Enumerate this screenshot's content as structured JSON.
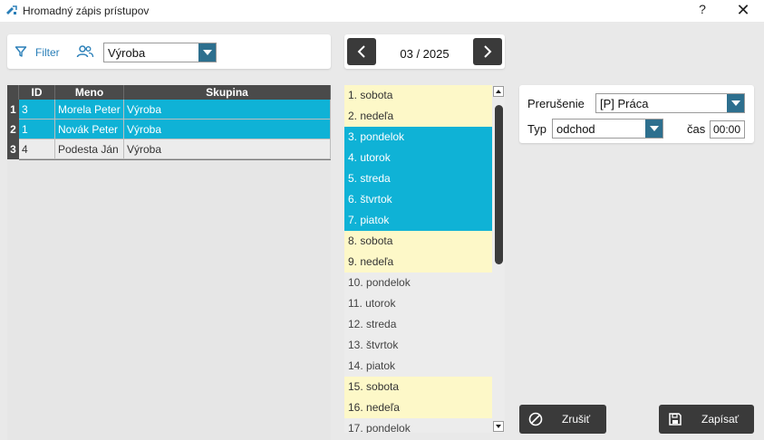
{
  "window": {
    "title": "Hromadný zápis prístupov",
    "help_label": "?",
    "close_label": "✕"
  },
  "filter": {
    "label": "Filter",
    "group_value": "Výroba"
  },
  "grid": {
    "headers": [
      "ID",
      "Meno",
      "Skupina"
    ],
    "rows": [
      {
        "num": "1",
        "id": "3",
        "name": "Morela Peter",
        "group": "Výroba",
        "selected": true
      },
      {
        "num": "2",
        "id": "1",
        "name": "Novák Peter",
        "group": "Výroba",
        "selected": true
      },
      {
        "num": "3",
        "id": "4",
        "name": "Podesta Ján",
        "group": "Výroba",
        "selected": false
      }
    ]
  },
  "month_nav": {
    "label": "03 / 2025"
  },
  "days": [
    {
      "label": "1. sobota",
      "kind": "weekend"
    },
    {
      "label": "2. nedeľa",
      "kind": "weekend"
    },
    {
      "label": "3. pondelok",
      "kind": "sel"
    },
    {
      "label": "4. utorok",
      "kind": "sel"
    },
    {
      "label": "5. streda",
      "kind": "sel"
    },
    {
      "label": "6. štvrtok",
      "kind": "sel"
    },
    {
      "label": "7. piatok",
      "kind": "sel"
    },
    {
      "label": "8. sobota",
      "kind": "weekend"
    },
    {
      "label": "9. nedeľa",
      "kind": "weekend"
    },
    {
      "label": "10. pondelok",
      "kind": "normal"
    },
    {
      "label": "11. utorok",
      "kind": "normal"
    },
    {
      "label": "12. streda",
      "kind": "normal"
    },
    {
      "label": "13. štvrtok",
      "kind": "normal"
    },
    {
      "label": "14. piatok",
      "kind": "normal"
    },
    {
      "label": "15. sobota",
      "kind": "weekend"
    },
    {
      "label": "16. nedeľa",
      "kind": "weekend"
    },
    {
      "label": "17. pondelok",
      "kind": "normal"
    }
  ],
  "form": {
    "interruption_label": "Prerušenie",
    "interruption_value": "[P] Práca",
    "type_label": "Typ",
    "type_value": "odchod",
    "time_label": "čas",
    "time_value": "00:00"
  },
  "buttons": {
    "cancel_label": "Zrušiť",
    "save_label": "Zapísať"
  },
  "colors": {
    "accent": "#0fb2d6",
    "weekend": "#fdf8c8",
    "dark": "#3a3a3a",
    "combo_button": "#2d6f8e"
  }
}
